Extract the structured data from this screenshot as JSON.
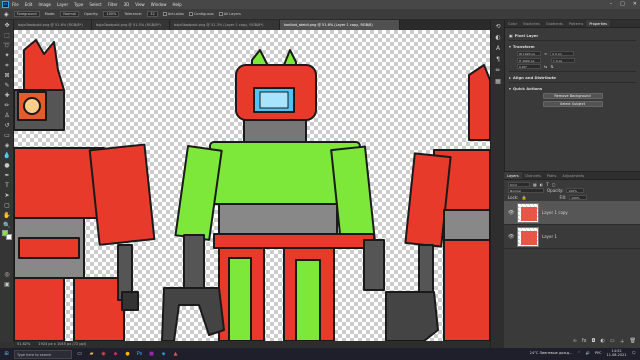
{
  "menu": {
    "app_icon": "Ps",
    "items": [
      "File",
      "Edit",
      "Image",
      "Layer",
      "Type",
      "Select",
      "Filter",
      "3D",
      "View",
      "Window",
      "Help"
    ]
  },
  "options": {
    "sample": "Foreground",
    "mode_label": "Mode:",
    "mode_value": "Normal",
    "opacity_label": "Opacity:",
    "opacity_value": "100%",
    "tolerance_label": "Tolerance:",
    "tolerance_value": "32",
    "antialias_label": "Anti-alias",
    "contiguous_label": "Contiguous",
    "all_layers_label": "All Layers"
  },
  "tabs": [
    "bojo0badpsbl.png @ 51.6% (RGB/8*)",
    "bojo0badpsbl.png @ 51.5% (RGB/8*)",
    "bojo0badpsbl.png @ 51.3% (Layer 1 copy, RGB/8*)",
    "konlbot_ateidi.png @ 51.6% (Layer 1 copy, RGB/8)"
  ],
  "status": {
    "zoom": "51.62%",
    "doc": "1924 px x 1045 px (72 ppi)"
  },
  "panel_tabs": [
    "Color",
    "Swatches",
    "Gradients",
    "Patterns",
    "Properties"
  ],
  "properties": {
    "kind": "Pixel Layer",
    "transform_title": "Transform",
    "w": "W 1920 px",
    "h": "H 1000 px",
    "x": "X 0 px",
    "y": "Y 0 px",
    "angle": "0.00°",
    "align_title": "Align and Distribute",
    "quick_actions_title": "Quick Actions",
    "btn_remove_bg": "Remove Background",
    "btn_select_subject": "Select Subject"
  },
  "layers_panel": {
    "tabs": [
      "Layers",
      "Channels",
      "Paths",
      "Adjustments"
    ],
    "kind_filter": "Kind",
    "blend_mode": "Normal",
    "opacity_label": "Opacity:",
    "opacity_value": "100%",
    "lock_label": "Lock:",
    "fill_label": "Fill:",
    "fill_value": "100%",
    "layers": [
      {
        "name": "Layer 1 copy",
        "selected": true
      },
      {
        "name": "Layer 1",
        "selected": false
      }
    ]
  },
  "taskbar": {
    "search_placeholder": "Type here to search",
    "weather": "24°C  Ливневые дожд…",
    "lang": "РУС",
    "time": "14:52",
    "date": "11.08.2021"
  },
  "colors": {
    "robot_red": "#e83a2a",
    "robot_green": "#7ee83a",
    "visor": "#4fc3f7",
    "outline": "#1a1a1a",
    "accent": "#31a8ff"
  }
}
